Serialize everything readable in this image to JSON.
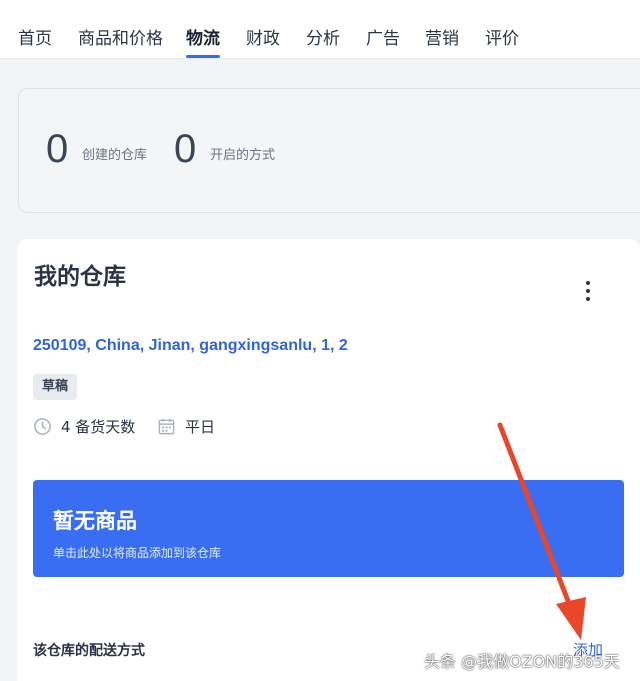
{
  "nav": {
    "tabs": [
      {
        "label": "首页"
      },
      {
        "label": "商品和价格"
      },
      {
        "label": "物流"
      },
      {
        "label": "财政"
      },
      {
        "label": "分析"
      },
      {
        "label": "广告"
      },
      {
        "label": "营销"
      },
      {
        "label": "评价"
      }
    ],
    "active_tab": "物流"
  },
  "stats": {
    "warehouses_created": {
      "value": "0",
      "label": "创建的仓库"
    },
    "methods_enabled": {
      "value": "0",
      "label": "开启的方式"
    }
  },
  "warehouse": {
    "title": "我的仓库",
    "address": "250109, China, Jinan, gangxingsanlu, 1, 2",
    "status_badge": "草稿",
    "prep_days": "4 备货天数",
    "schedule": "平日",
    "empty_products": {
      "title": "暂无商品",
      "subtitle": "单击此处以将商品添加到该仓库"
    },
    "delivery_methods_label": "该仓库的配送方式",
    "add_link": "添加"
  },
  "overlay": {
    "watermark": "头条 @我做OZON的365天",
    "arrow_color": "#e8472b"
  },
  "icons": {
    "clock": "clock-icon",
    "calendar": "calendar-icon",
    "menu": "more-vertical-icon"
  },
  "colors": {
    "accent": "#3a6ef2",
    "link": "#2f66d6",
    "arrow": "#e8472b"
  }
}
